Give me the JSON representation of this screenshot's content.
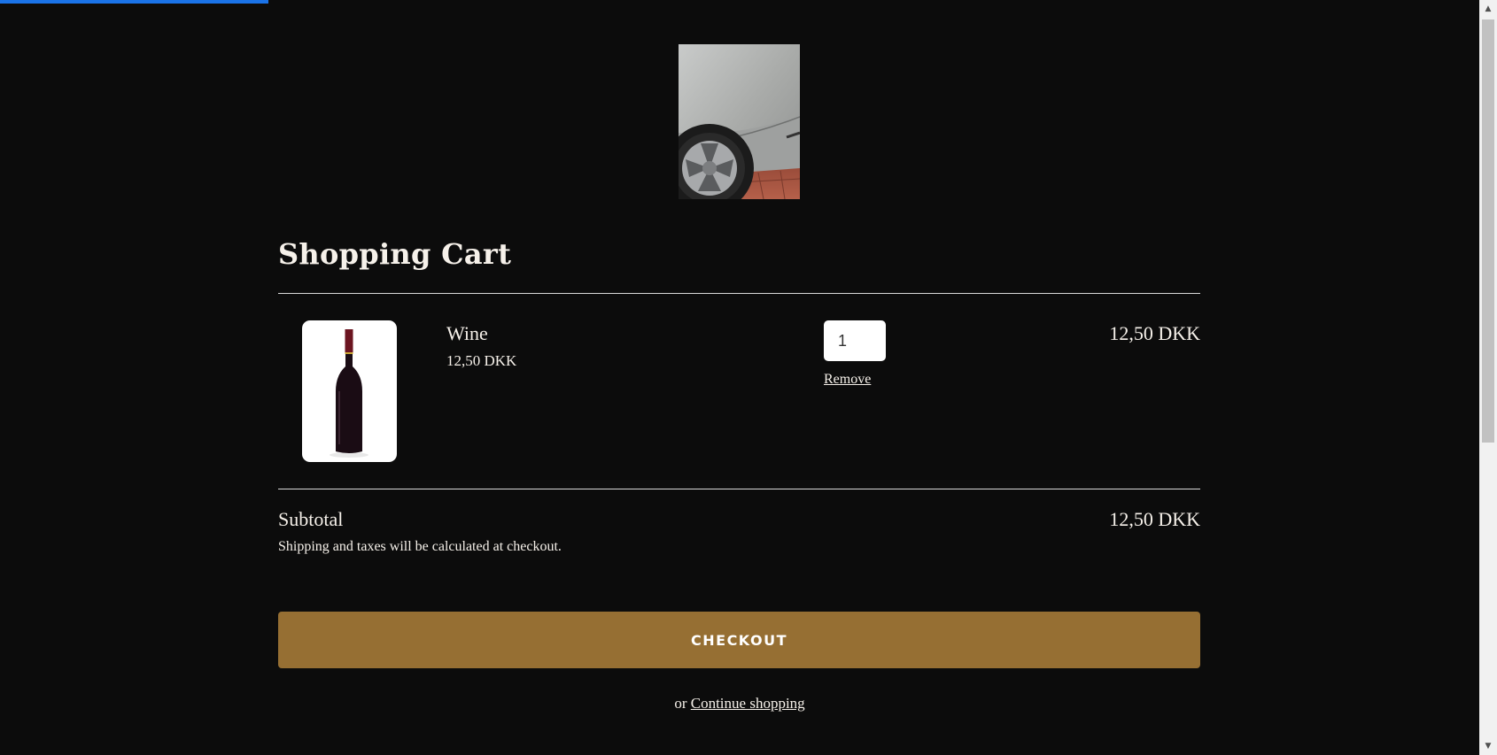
{
  "cart": {
    "title": "Shopping Cart",
    "items": [
      {
        "name": "Wine",
        "unit_price": "12,50 DKK",
        "quantity": "1",
        "remove_label": "Remove",
        "line_total": "12,50 DKK"
      }
    ],
    "subtotal_label": "Subtotal",
    "subtotal_value": "12,50 DKK",
    "shipping_note": "Shipping and taxes will be calculated at checkout.",
    "checkout_label": "CHECKOUT",
    "continue_prefix": "or",
    "continue_label": "Continue shopping"
  },
  "colors": {
    "background": "#0c0c0c",
    "accent": "#966f33",
    "loading_bar": "#1a73e8"
  }
}
